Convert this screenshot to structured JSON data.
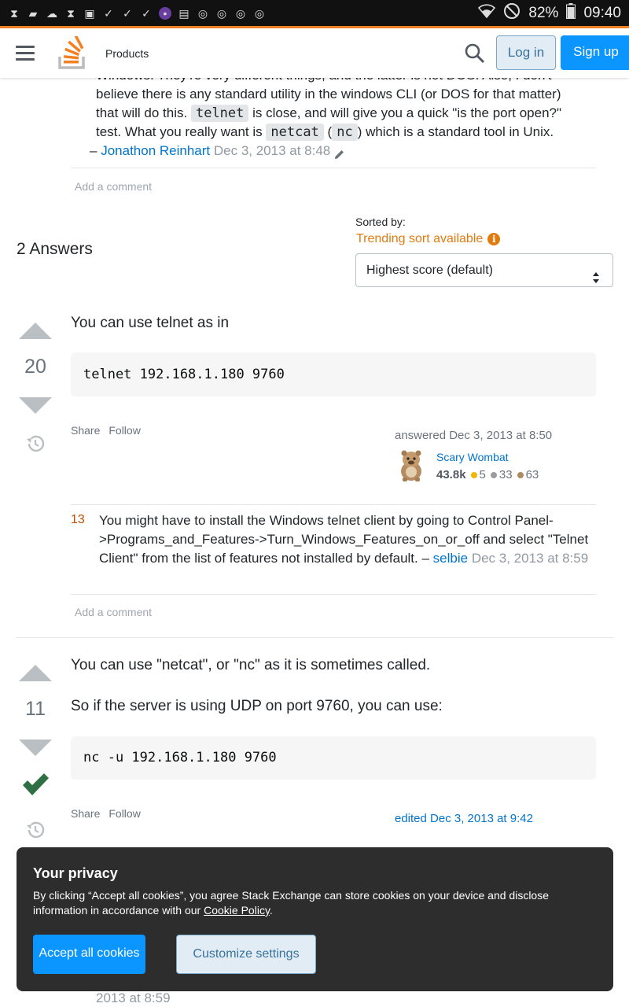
{
  "status_bar": {
    "battery": "82%",
    "time": "09:40",
    "icons": [
      "hourglass-icon",
      "message-icon",
      "cloud-icon",
      "hourglass-icon",
      "image-icon",
      "check-icon",
      "check-icon",
      "check-icon",
      "app-icon",
      "screenshot-icon",
      "chrome-icon",
      "chrome-icon",
      "chrome-icon",
      "chrome-icon"
    ]
  },
  "header": {
    "products_label": "Products",
    "login_label": "Log in",
    "signup_label": "Sign up"
  },
  "top_comment": {
    "line0": "Windows. They're very different things, and the latter is not DOS. Also, I don't",
    "text1": "believe there is any standard utility in the windows CLI (or DOS for that matter) that will do this.",
    "code1": "telnet",
    "text2": "is close, and will give you a quick \"is the port open?\" test. What you really want is",
    "code2": "netcat",
    "paren_open": "(",
    "code3": "nc",
    "text3": ") which is a standard tool in Unix.",
    "dash": "–",
    "author": "Jonathon Reinhart",
    "date": "Dec 3, 2013 at 8:48"
  },
  "add_comment_label": "Add a comment",
  "answers_header": {
    "count": "2 Answers",
    "sorted_by": "Sorted by:",
    "trending": "Trending sort available",
    "sort_value": "Highest score (default)"
  },
  "answer1": {
    "score": "20",
    "text": "You can use telnet as in",
    "code": "telnet 192.168.1.180 9760",
    "share": "Share",
    "follow": "Follow",
    "answered": "answered Dec 3, 2013 at 8:50",
    "user_name": "Scary Wombat",
    "reputation": "43.8k",
    "gold": "5",
    "silver": "33",
    "bronze": "63",
    "comment_score": "13",
    "comment_text": "You might have to install the Windows telnet client by going to Control Panel->Programs_and_Features->Turn_Windows_Features_on_or_off and select \"Telnet Client\" from the list of features not installed by default. –",
    "comment_author": "selbie",
    "comment_date": "Dec 3, 2013 at 8:59"
  },
  "answer2": {
    "score": "11",
    "text1": "You can use \"netcat\", or \"nc\" as it is sometimes called.",
    "text2": "So if the server is using UDP on port 9760, you can use:",
    "code": "nc -u 192.168.1.180 9760",
    "share": "Share",
    "follow": "Follow",
    "edited": "edited Dec 3, 2013 at 9:42"
  },
  "cookie": {
    "title": "Your privacy",
    "text": "By clicking “Accept all cookies”, you agree Stack Exchange can store cookies on your device and disclose information in accordance with our",
    "link": "Cookie Policy",
    "period": ".",
    "accept": "Accept all cookies",
    "customize": "Customize settings"
  },
  "peek_date": "2013 at 8:59",
  "colors": {
    "accent_orange": "#f48225",
    "primary_blue": "#0a95ff",
    "link_blue": "#0074cc",
    "accepted_green": "#2f6f44"
  }
}
